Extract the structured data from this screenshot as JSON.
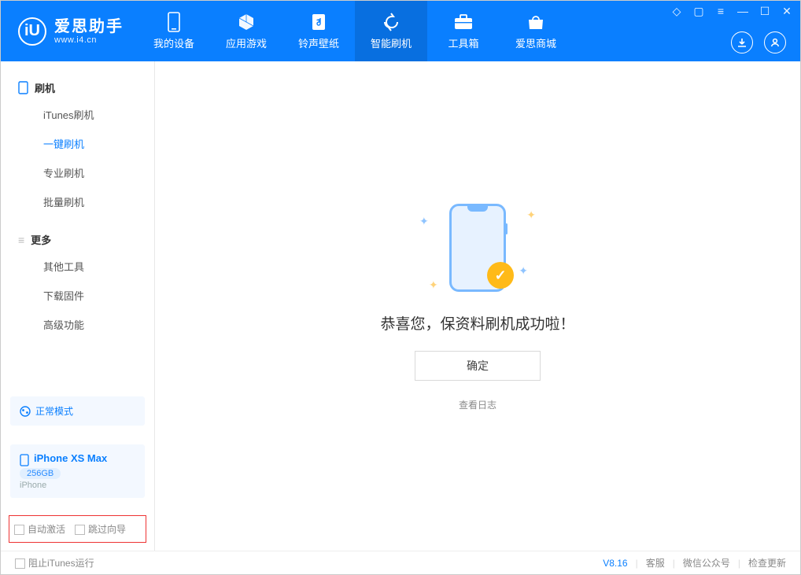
{
  "app": {
    "title": "爱思助手",
    "url": "www.i4.cn",
    "logo_letter": "iU"
  },
  "tabs": [
    {
      "label": "我的设备",
      "icon": "device-icon"
    },
    {
      "label": "应用游戏",
      "icon": "cube-icon"
    },
    {
      "label": "铃声壁纸",
      "icon": "music-icon"
    },
    {
      "label": "智能刷机",
      "icon": "refresh-icon",
      "active": true
    },
    {
      "label": "工具箱",
      "icon": "toolbox-icon"
    },
    {
      "label": "爱思商城",
      "icon": "shop-icon"
    }
  ],
  "sidebar": {
    "section1_title": "刷机",
    "section1_items": [
      {
        "label": "iTunes刷机"
      },
      {
        "label": "一键刷机",
        "active": true
      },
      {
        "label": "专业刷机"
      },
      {
        "label": "批量刷机"
      }
    ],
    "section2_title": "更多",
    "section2_items": [
      {
        "label": "其他工具"
      },
      {
        "label": "下载固件"
      },
      {
        "label": "高级功能"
      }
    ],
    "mode_label": "正常模式",
    "device_name": "iPhone XS Max",
    "device_storage": "256GB",
    "device_type": "iPhone",
    "checkbox1": "自动激活",
    "checkbox2": "跳过向导"
  },
  "main": {
    "success_text": "恭喜您，保资料刷机成功啦！",
    "ok_button": "确定",
    "log_link": "查看日志"
  },
  "footer": {
    "stop_itunes": "阻止iTunes运行",
    "version": "V8.16",
    "link1": "客服",
    "link2": "微信公众号",
    "link3": "检查更新"
  }
}
